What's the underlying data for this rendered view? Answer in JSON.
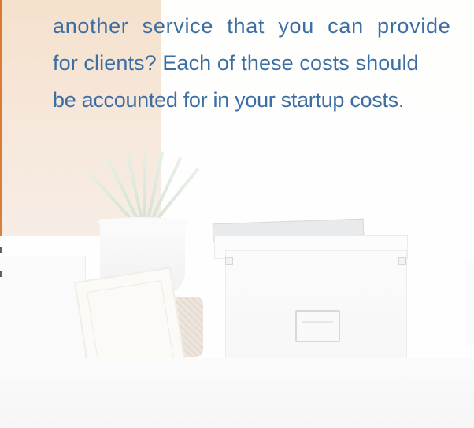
{
  "content": {
    "lines": [
      "another service that you can provide",
      "for clients? Each of these costs should",
      "be accounted for in your startup costs."
    ]
  },
  "colors": {
    "text": "#3c6ea3",
    "accent_orange": "#d97a33",
    "background": "#f6f4f1"
  }
}
